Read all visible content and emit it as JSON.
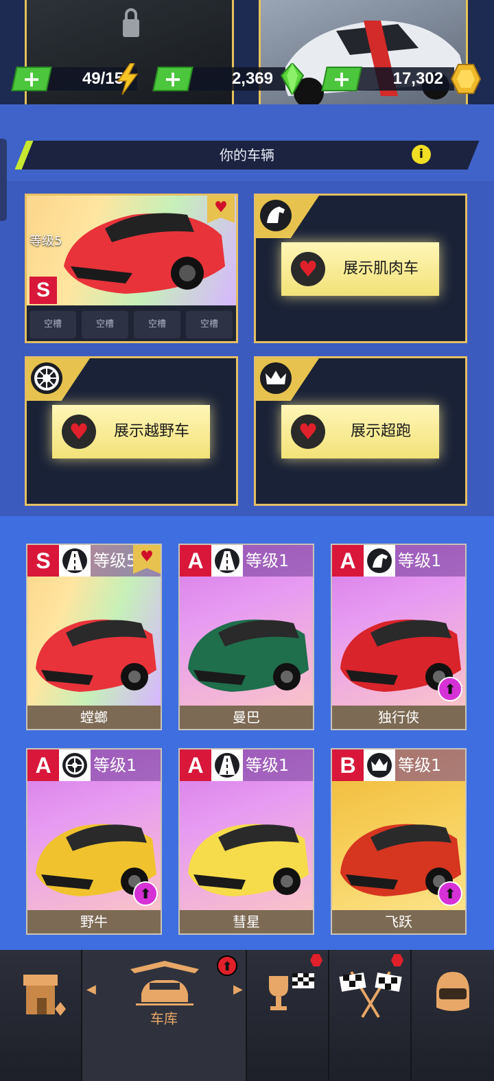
{
  "resources": [
    {
      "name": "fuel",
      "value": "49/15",
      "icon": "lightning-icon",
      "plus": "+"
    },
    {
      "name": "gems",
      "value": "2,369",
      "icon": "green-gem-icon",
      "plus": "+"
    },
    {
      "name": "coins",
      "value": "17,302",
      "icon": "gold-coin-icon",
      "plus": "+"
    }
  ],
  "section": {
    "title": "你的车辆",
    "info": "i"
  },
  "featured": {
    "level": "等级5",
    "rank": "S",
    "class_icon": "road-icon",
    "parts": [
      "空槽",
      "空槽",
      "空槽",
      "空槽"
    ]
  },
  "showcase": [
    {
      "class_icon": "horse-icon",
      "button": "展示肌肉车"
    },
    {
      "class_icon": "tire-icon",
      "button": "展示越野车"
    },
    {
      "class_icon": "crown-icon",
      "button": "展示超跑"
    }
  ],
  "cars": [
    {
      "rank": "S",
      "class_icon": "road-icon",
      "level": "等级5",
      "name": "螳螂",
      "favorite": true,
      "upgrade": false,
      "color": "#e8333a"
    },
    {
      "rank": "A",
      "class_icon": "road-icon",
      "level": "等级1",
      "name": "曼巴",
      "favorite": false,
      "upgrade": false,
      "color": "#1f6e4c"
    },
    {
      "rank": "A",
      "class_icon": "horse-icon",
      "level": "等级1",
      "name": "独行侠",
      "favorite": false,
      "upgrade": true,
      "color": "#d8242a"
    },
    {
      "rank": "A",
      "class_icon": "tire-icon",
      "level": "等级1",
      "name": "野牛",
      "favorite": false,
      "upgrade": true,
      "color": "#f0c32e"
    },
    {
      "rank": "A",
      "class_icon": "road-icon",
      "level": "等级1",
      "name": "彗星",
      "favorite": false,
      "upgrade": false,
      "color": "#f6dc4a"
    },
    {
      "rank": "B",
      "class_icon": "crown-icon",
      "level": "等级1",
      "name": "飞跃",
      "favorite": false,
      "upgrade": true,
      "color": "#d63520"
    }
  ],
  "nav": {
    "items": [
      {
        "name": "shop",
        "icon": "shop-icon"
      },
      {
        "name": "garage",
        "icon": "garage-car-icon",
        "label": "车库",
        "badge": "⬆"
      },
      {
        "name": "trophies",
        "icon": "trophy-flag-icon"
      },
      {
        "name": "races",
        "icon": "checkered-flags-icon"
      },
      {
        "name": "profile",
        "icon": "helmet-icon"
      }
    ]
  }
}
